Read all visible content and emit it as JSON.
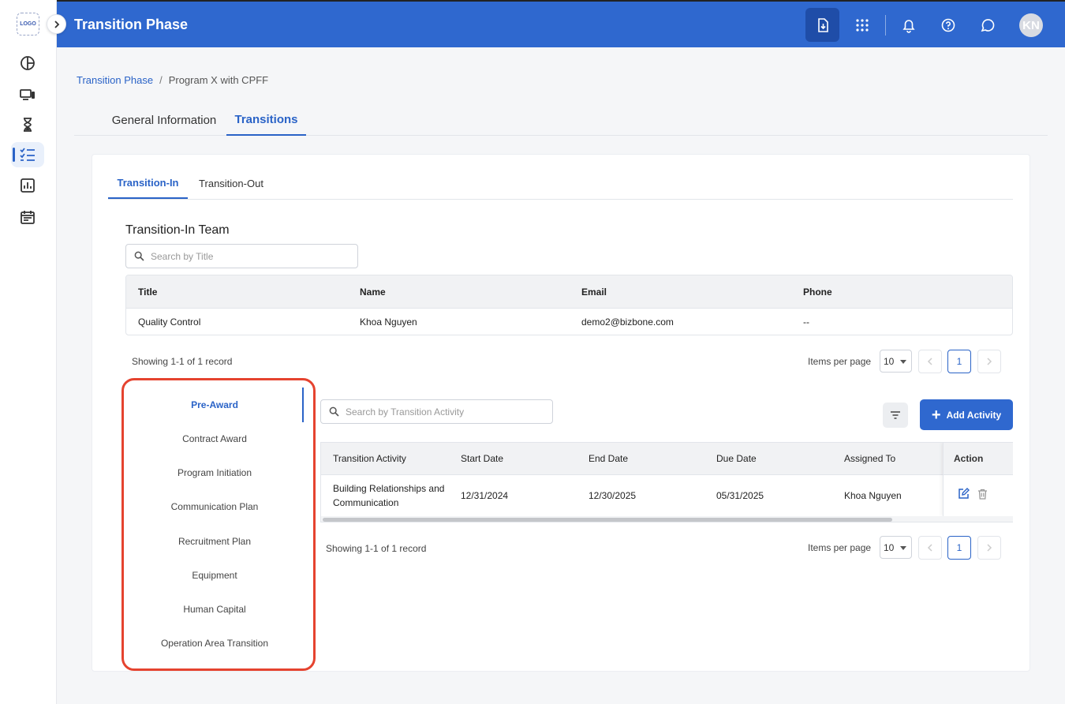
{
  "sidebar": {
    "logo": "LOGO",
    "items": [
      {
        "icon": "pie-chart-icon"
      },
      {
        "icon": "devices-icon"
      },
      {
        "icon": "hourglass-icon"
      },
      {
        "icon": "checklist-icon",
        "active": true
      },
      {
        "icon": "report-icon"
      },
      {
        "icon": "calendar-icon"
      }
    ]
  },
  "header": {
    "title": "Transition Phase",
    "avatar_initials": "KN",
    "accent": "#2f68cf"
  },
  "breadcrumb": {
    "parent": "Transition Phase",
    "separator": "/",
    "current": "Program X with CPFF"
  },
  "main_tabs": [
    {
      "label": "General Information"
    },
    {
      "label": "Transitions",
      "active": true
    }
  ],
  "sub_tabs": [
    {
      "label": "Transition-In",
      "active": true
    },
    {
      "label": "Transition-Out"
    }
  ],
  "team": {
    "title": "Transition-In Team",
    "search_placeholder": "Search by Title",
    "columns": [
      "Title",
      "Name",
      "Email",
      "Phone"
    ],
    "rows": [
      [
        "Quality Control",
        "Khoa Nguyen",
        "demo2@bizbone.com",
        "--"
      ]
    ],
    "showing": "Showing 1-1 of 1 record",
    "items_per_page_label": "Items per page",
    "items_per_page": "10",
    "page": "1"
  },
  "phases": [
    {
      "label": "Pre-Award",
      "active": true
    },
    {
      "label": "Contract Award"
    },
    {
      "label": "Program Initiation"
    },
    {
      "label": "Communication Plan"
    },
    {
      "label": "Recruitment Plan"
    },
    {
      "label": "Equipment"
    },
    {
      "label": "Human Capital"
    },
    {
      "label": "Operation Area Transition"
    }
  ],
  "activities": {
    "search_placeholder": "Search by Transition Activity",
    "add_label": "Add Activity",
    "columns": [
      "Transition Activity",
      "Start Date",
      "End Date",
      "Due Date",
      "Assigned To",
      "Action"
    ],
    "rows": [
      [
        "Building Relationships and Communication",
        "12/31/2024",
        "12/30/2025",
        "05/31/2025",
        "Khoa Nguyen"
      ]
    ],
    "showing": "Showing 1-1 of 1 record",
    "items_per_page_label": "Items per page",
    "items_per_page": "10",
    "page": "1"
  },
  "highlight_color": "#e5432f"
}
